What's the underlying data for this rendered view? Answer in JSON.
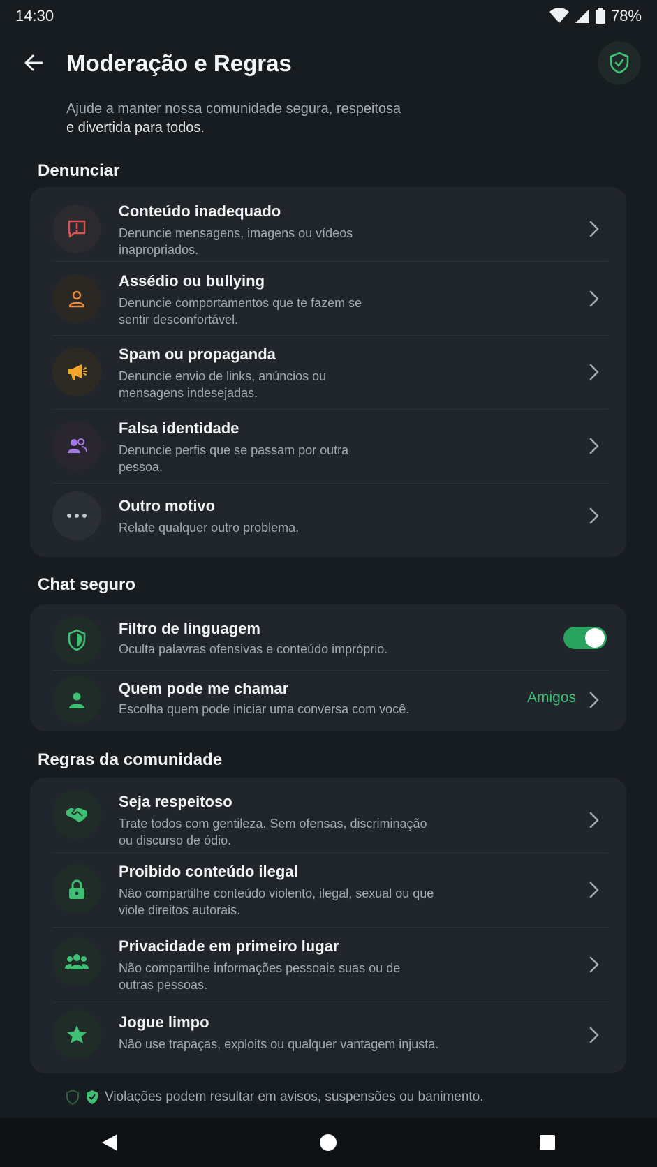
{
  "status_bar": {
    "time": "14:30",
    "battery": "78%"
  },
  "header": {
    "title": "Moderação e Regras"
  },
  "intro": {
    "line1": "Ajude a manter nossa comunidade segura, respeitosa",
    "line2": "e divertida para todos."
  },
  "report": {
    "title": "Denunciar",
    "items": [
      {
        "title": "Conteúdo inadequado",
        "desc1": "Denuncie mensagens, imagens ou vídeos",
        "desc2": "inapropriados.",
        "icon": "alert-message-icon",
        "color": "#e0504f"
      },
      {
        "title": "Assédio ou bullying",
        "desc1": "Denuncie comportamentos que te fazem se",
        "desc2": "sentir desconfortável.",
        "icon": "person-icon",
        "color": "#ea8a3c"
      },
      {
        "title": "Spam ou propaganda",
        "desc1": "Denuncie envio de links, anúncios ou",
        "desc2": "mensagens indesejadas.",
        "icon": "megaphone-icon",
        "color": "#f0a52b"
      },
      {
        "title": "Falsa identidade",
        "desc1": "Denuncie perfis que se passam por outra",
        "desc2": "pessoa.",
        "icon": "people-icon",
        "color": "#a578e8"
      },
      {
        "title": "Outro motivo",
        "desc1": "Relate qualquer outro problema.",
        "desc2": "",
        "icon": "more-dots-icon",
        "color": "#c3c8cc"
      }
    ]
  },
  "safe_chat": {
    "title": "Chat seguro",
    "filter": {
      "title": "Filtro de linguagem",
      "desc": "Oculta palavras ofensivas e conteúdo impróprio.",
      "enabled": true
    },
    "who_can_call": {
      "title": "Quem pode me chamar",
      "desc": "Escolha quem pode iniciar uma conversa com você.",
      "value": "Amigos"
    }
  },
  "rules": {
    "title": "Regras da comunidade",
    "items": [
      {
        "title": "Seja respeitoso",
        "desc1": "Trate todos com gentileza. Sem ofensas, discriminação",
        "desc2": "ou discurso de ódio.",
        "icon": "handshake-icon"
      },
      {
        "title": "Proibido conteúdo ilegal",
        "desc1": "Não compartilhe conteúdo violento, ilegal, sexual ou que",
        "desc2": "viole direitos autorais.",
        "icon": "lock-icon"
      },
      {
        "title": "Privacidade em primeiro lugar",
        "desc1": "Não compartilhe informações pessoais suas ou de",
        "desc2": "outras pessoas.",
        "icon": "group-icon"
      },
      {
        "title": "Jogue limpo",
        "desc1": "Não use trapaças, exploits ou qualquer vantagem injusta.",
        "desc2": "",
        "icon": "star-icon"
      }
    ]
  },
  "footer": {
    "note": "Violações podem resultar em avisos, suspensões ou banimento."
  },
  "colors": {
    "accent": "#3fbf74",
    "background": "#171c21",
    "card": "#20262c"
  }
}
